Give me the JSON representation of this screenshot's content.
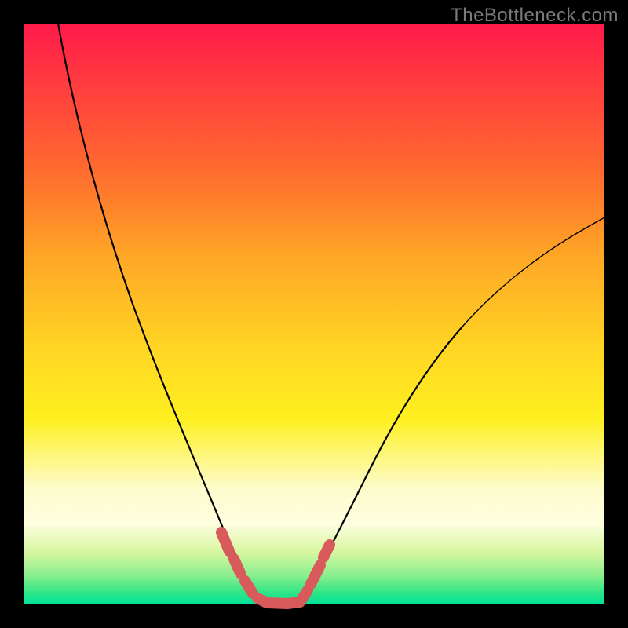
{
  "watermark": "TheBottleneck.com",
  "chart_data": {
    "type": "line",
    "title": "",
    "xlabel": "",
    "ylabel": "",
    "xlim": [
      0,
      100
    ],
    "ylim": [
      0,
      100
    ],
    "grid": false,
    "legend": false,
    "series": [
      {
        "name": "left-curve",
        "x": [
          6,
          10,
          14,
          18,
          22,
          26,
          30,
          34,
          36,
          38,
          40
        ],
        "y": [
          100,
          80,
          62,
          48,
          36,
          26,
          17,
          9,
          5,
          2,
          0
        ]
      },
      {
        "name": "right-curve",
        "x": [
          44,
          48,
          52,
          58,
          64,
          72,
          80,
          88,
          96,
          100
        ],
        "y": [
          0,
          4,
          10,
          19,
          29,
          40,
          50,
          58,
          65,
          68
        ]
      },
      {
        "name": "valley-floor",
        "x": [
          36,
          38,
          40,
          42,
          44,
          46,
          48
        ],
        "y": [
          5,
          2,
          0,
          0,
          0,
          2,
          5
        ]
      }
    ],
    "annotations": [
      {
        "text": "TheBottleneck.com",
        "position": "top-right"
      }
    ],
    "marker_color": "#d95a5a",
    "curve_color": "#000000",
    "background_gradient": [
      "#ff1a4b",
      "#ffa626",
      "#fff020",
      "#2ee587"
    ]
  }
}
